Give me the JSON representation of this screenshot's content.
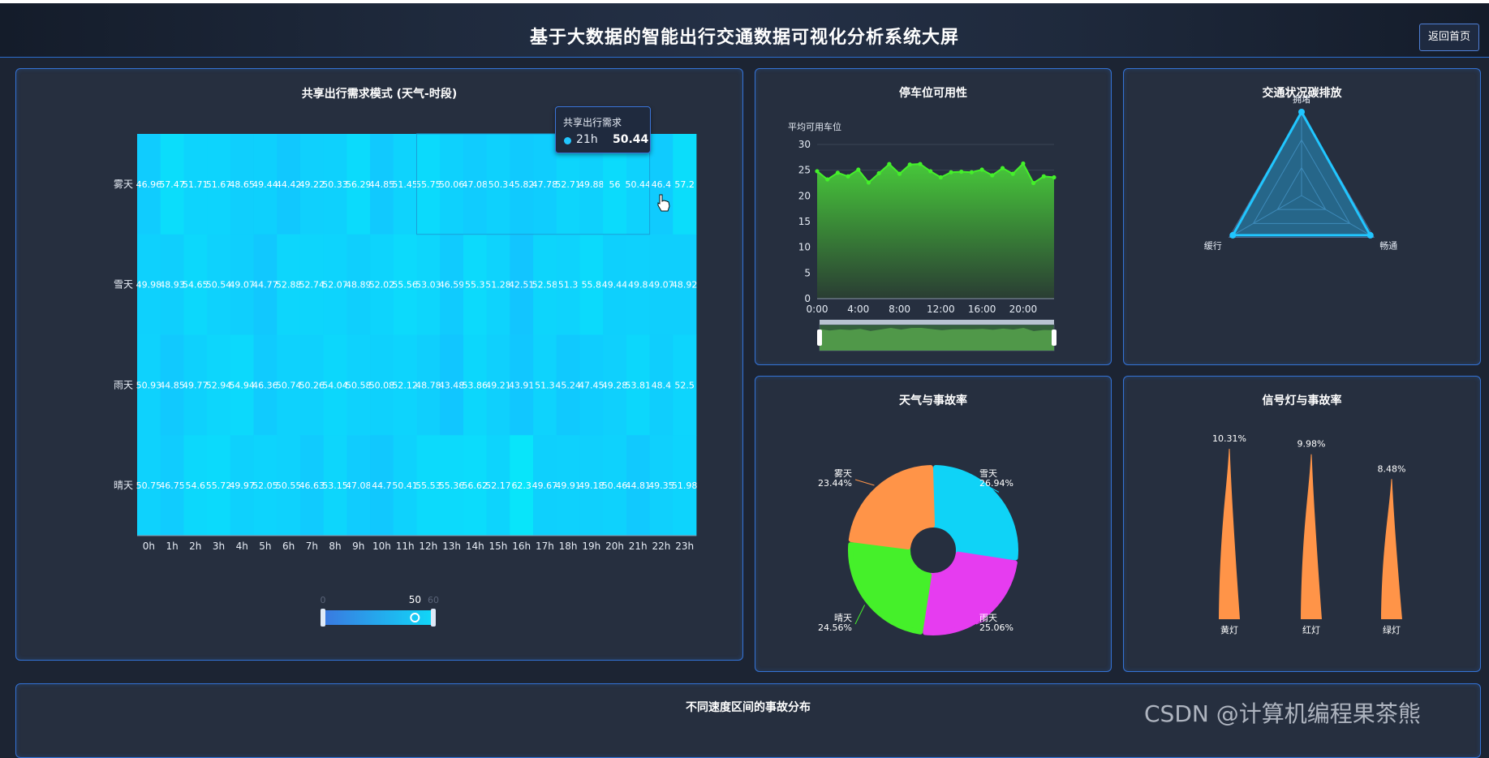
{
  "header": {
    "title": "基于大数据的智能出行交通数据可视化分析系统大屏",
    "home_button": "返回首页"
  },
  "colors": {
    "accent": "#3473d6",
    "panel_bg": "#262f3f",
    "page_bg": "#1c2433"
  },
  "panels": {
    "heatmap": {
      "title": "共享出行需求模式 (天气-时段)"
    },
    "parking": {
      "title": "停车位可用性"
    },
    "traffic": {
      "title": "交通状况碳排放"
    },
    "weather": {
      "title": "天气与事故率"
    },
    "signal": {
      "title": "信号灯与事故率"
    },
    "speed": {
      "title": "不同速度区间的事故分布"
    }
  },
  "tooltip": {
    "title": "共享出行需求",
    "label": "21h",
    "value": "50.44"
  },
  "watermark": "CSDN @计算机编程果茶熊",
  "chart_data": [
    {
      "type": "heatmap",
      "title": "共享出行需求模式 (天气-时段)",
      "x": [
        "0h",
        "1h",
        "2h",
        "3h",
        "4h",
        "5h",
        "6h",
        "7h",
        "8h",
        "9h",
        "10h",
        "11h",
        "12h",
        "13h",
        "14h",
        "15h",
        "16h",
        "17h",
        "18h",
        "19h",
        "20h",
        "21h",
        "22h",
        "23h"
      ],
      "y": [
        "雾天",
        "雪天",
        "雨天",
        "晴天"
      ],
      "values": [
        [
          46.96,
          57.47,
          51.71,
          51.67,
          48.65,
          49.44,
          44.42,
          49.22,
          50.33,
          56.29,
          44.85,
          51.45,
          55.75,
          50.06,
          47.08,
          50.3,
          45.82,
          47.78,
          52.71,
          49.88,
          56,
          50.44,
          46.4,
          57.2
        ],
        [
          49.98,
          48.93,
          54.65,
          50.54,
          49.07,
          44.77,
          52.88,
          52.74,
          52.07,
          48.89,
          52.02,
          55.56,
          53.03,
          46.59,
          55.3,
          51.28,
          42.51,
          52.58,
          51.3,
          55.8,
          49.44,
          49.8,
          49.07,
          48.92
        ],
        [
          50.93,
          44.85,
          49.77,
          52.94,
          54.94,
          46.36,
          50.74,
          50.26,
          54.04,
          50.58,
          50.08,
          52.12,
          48.78,
          43.48,
          53.86,
          49.21,
          43.91,
          51.3,
          45.24,
          47.45,
          49.28,
          53.81,
          48.4,
          52.5
        ],
        [
          50.75,
          46.75,
          54.6,
          55.72,
          49.97,
          52.05,
          50.55,
          46.63,
          53.15,
          47.08,
          44.7,
          50.41,
          55.53,
          55.36,
          56.62,
          52.17,
          62.3,
          49.67,
          49.91,
          49.18,
          50.46,
          44.81,
          49.35,
          51.98
        ]
      ],
      "visual_map": {
        "min": "0",
        "max": "60",
        "value": "50"
      }
    },
    {
      "type": "area",
      "title": "停车位可用性",
      "ylabel": "平均可用车位",
      "x_ticks": [
        "0:00",
        "4:00",
        "8:00",
        "12:00",
        "16:00",
        "20:00"
      ],
      "y_ticks": [
        "0",
        "5",
        "10",
        "15",
        "20",
        "25",
        "30"
      ],
      "ylim": [
        0,
        30
      ],
      "x": [
        0,
        1,
        2,
        3,
        4,
        5,
        6,
        7,
        8,
        9,
        10,
        11,
        12,
        13,
        14,
        15,
        16,
        17,
        18,
        19,
        20,
        21,
        22,
        23
      ],
      "values": [
        24.8,
        23.2,
        24.5,
        23.8,
        25.1,
        22.6,
        24.4,
        26.2,
        24.3,
        26.1,
        26.2,
        24.8,
        23.6,
        24.6,
        24.7,
        24.6,
        25.1,
        24.0,
        25.4,
        24.3,
        26.3,
        22.5,
        23.8,
        23.6
      ]
    },
    {
      "type": "radar",
      "title": "交通状况碳排放",
      "indicators": [
        "拥堵",
        "畅通",
        "缓行"
      ],
      "values": [
        1.0,
        0.95,
        0.95
      ]
    },
    {
      "type": "pie",
      "title": "天气与事故率",
      "slices": [
        {
          "name": "雪天",
          "value": 26.94,
          "label": "26.94%",
          "color": "#0fd3f7"
        },
        {
          "name": "雨天",
          "value": 25.06,
          "label": "25.06%",
          "color": "#e63cf0"
        },
        {
          "name": "晴天",
          "value": 24.56,
          "label": "24.56%",
          "color": "#45f02a"
        },
        {
          "name": "雾天",
          "value": 23.44,
          "label": "23.44%",
          "color": "#ff9448"
        }
      ]
    },
    {
      "type": "bar",
      "title": "信号灯与事故率",
      "categories": [
        "黄灯",
        "红灯",
        "绿灯"
      ],
      "values": [
        10.31,
        9.98,
        8.48
      ],
      "labels": [
        "10.31%",
        "9.98%",
        "8.48%"
      ],
      "color": "#ff9448"
    }
  ]
}
